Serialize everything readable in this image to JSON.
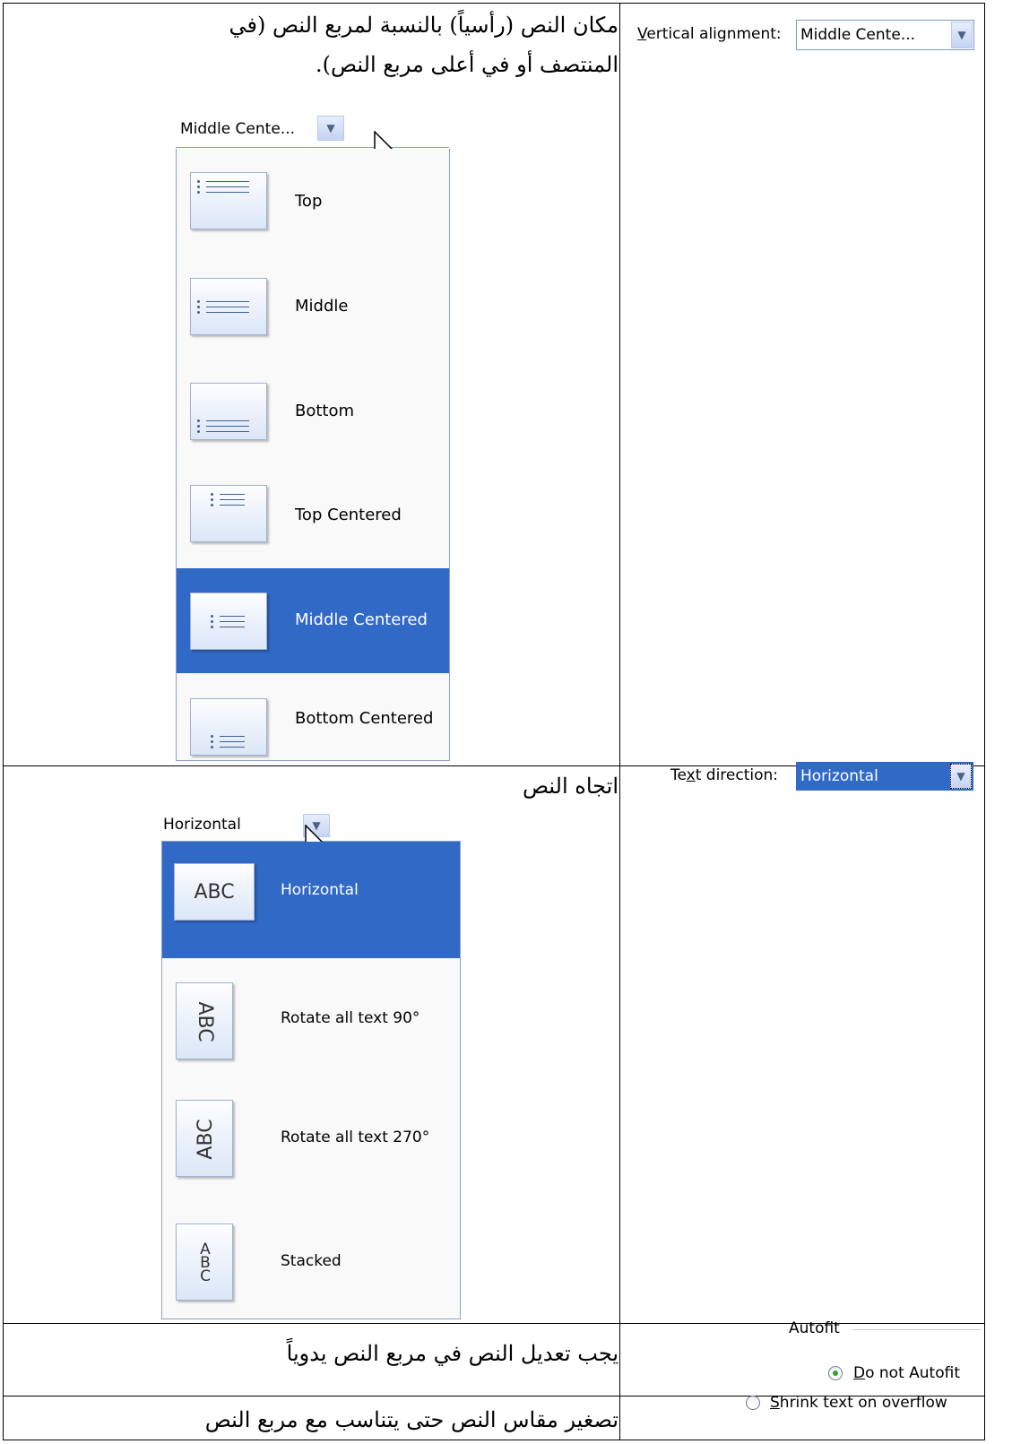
{
  "rows": [
    {
      "description": "مكان النص (رأسياً) بالنسبة لمربع النص (في المنتصف أو في أعلى مربع النص).",
      "property": {
        "label_pre": "",
        "label_accel": "V",
        "label_post": "ertical alignment:",
        "value": "Middle Cente..."
      },
      "dropdown": {
        "value": "Middle Cente...",
        "options": [
          {
            "label": "Top",
            "icon": "align-top-icon"
          },
          {
            "label": "Middle",
            "icon": "align-middle-icon"
          },
          {
            "label": "Bottom",
            "icon": "align-bottom-icon"
          },
          {
            "label": "Top Centered",
            "icon": "align-top-centered-icon"
          },
          {
            "label": "Middle Centered",
            "icon": "align-middle-centered-icon",
            "selected": true
          },
          {
            "label": "Bottom Centered",
            "icon": "align-bottom-centered-icon"
          }
        ]
      }
    },
    {
      "description": "اتجاه النص",
      "property": {
        "label_pre": "Te",
        "label_accel": "x",
        "label_post": "t direction:",
        "value": "Horizontal"
      },
      "dropdown": {
        "value": "Horizontal",
        "options": [
          {
            "label": "Horizontal",
            "icon": "abc-horizontal-icon",
            "icon_text": "ABC",
            "selected": true
          },
          {
            "label": "Rotate all text 90°",
            "icon": "abc-rotate-90-icon",
            "icon_text": "ABC"
          },
          {
            "label": "Rotate all text 270°",
            "icon": "abc-rotate-270-icon",
            "icon_text": "ABC"
          },
          {
            "label": "Stacked",
            "icon": "abc-stacked-icon",
            "icon_text": "ABC"
          }
        ]
      }
    },
    {
      "description": "يجب تعديل النص في مربع النص يدوياً",
      "group_label": "Autofit",
      "option": {
        "accel": "D",
        "rest": "o not Autofit",
        "checked": true
      }
    },
    {
      "description": "تصغير مقاس النص حتى يتناسب مع مربع النص",
      "option": {
        "accel": "S",
        "rest": "hrink text on overflow",
        "checked": false
      }
    }
  ],
  "colors": {
    "selection": "#3169c6",
    "popup_bg": "#f9f9f9",
    "radio_dot": "#3a9d2f"
  }
}
